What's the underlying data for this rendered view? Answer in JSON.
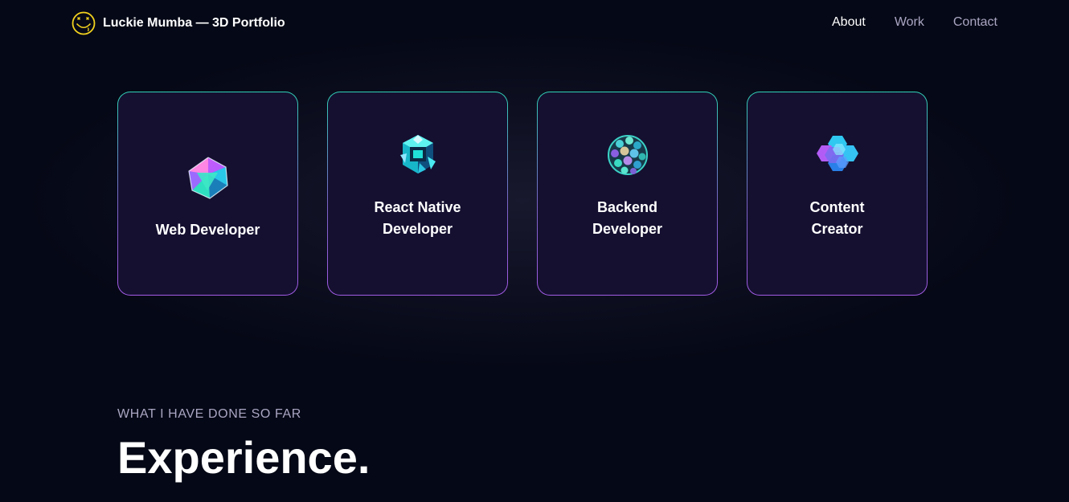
{
  "nav": {
    "brand_title": "Luckie Mumba — 3D Portfolio",
    "logo_icon": "smiley-face-icon",
    "links": [
      {
        "label": "About",
        "active": true
      },
      {
        "label": "Work",
        "active": false
      },
      {
        "label": "Contact",
        "active": false
      }
    ]
  },
  "services": [
    {
      "title": "Web Developer",
      "icon": "faceted-gem-icon"
    },
    {
      "title": "React Native Developer",
      "icon": "crystal-cube-icon"
    },
    {
      "title": "Backend Developer",
      "icon": "bead-sphere-icon"
    },
    {
      "title": "Content Creator",
      "icon": "hexagon-cluster-icon"
    }
  ],
  "experience": {
    "subtitle": "WHAT I HAVE DONE SO FAR",
    "heading": "Experience."
  },
  "colors": {
    "background": "#050816",
    "card_background": "#151030",
    "secondary_text": "#aaa6c3",
    "border_top": "#2fd3b6",
    "border_bottom": "#a35be6",
    "logo_yellow": "#f2d21e"
  }
}
